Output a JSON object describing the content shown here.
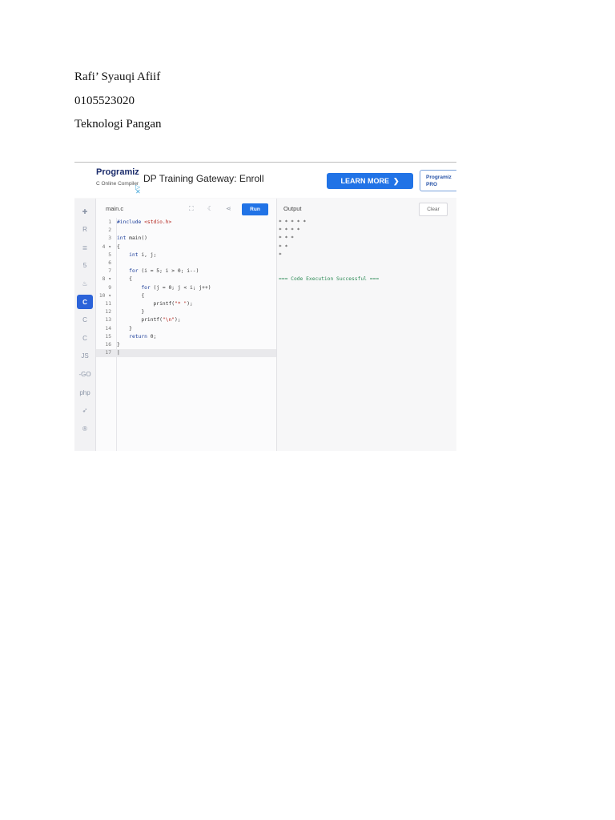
{
  "document": {
    "lines": [
      "Rafi’ Syauqi Afiif",
      "0105523020",
      "Teknologi Pangan"
    ]
  },
  "ad": {
    "logo_text": "Programiz",
    "logo_sub": "C Online Compiler",
    "title": "DP Training Gateway: Enroll",
    "learn_more": "LEARN MORE",
    "pro_label": "Programiz PRO",
    "close_glyph": "▷ ✕"
  },
  "sidebar": {
    "active_index": 5,
    "items": [
      {
        "icon": "python-icon",
        "glyph": "✚"
      },
      {
        "icon": "r-icon",
        "glyph": "R"
      },
      {
        "icon": "sql-icon",
        "glyph": "≣"
      },
      {
        "icon": "html-icon",
        "glyph": "5"
      },
      {
        "icon": "java-icon",
        "glyph": "♨"
      },
      {
        "icon": "c-icon",
        "glyph": "C"
      },
      {
        "icon": "cpp-icon",
        "glyph": "C"
      },
      {
        "icon": "csharp-icon",
        "glyph": "C"
      },
      {
        "icon": "javascript-icon",
        "glyph": "JS"
      },
      {
        "icon": "go-icon",
        "glyph": "-GO"
      },
      {
        "icon": "php-icon",
        "glyph": "php"
      },
      {
        "icon": "swift-icon",
        "glyph": "➶"
      },
      {
        "icon": "rust-icon",
        "glyph": "®"
      }
    ]
  },
  "editor": {
    "filename": "main.c",
    "run_label": "Run",
    "lines": [
      {
        "n": "1",
        "fold": "",
        "code": "#include <stdio.h>"
      },
      {
        "n": "2",
        "fold": "",
        "code": ""
      },
      {
        "n": "3",
        "fold": "",
        "code": "int main()"
      },
      {
        "n": "4",
        "fold": "▾",
        "code": "{"
      },
      {
        "n": "5",
        "fold": "",
        "code": "    int i, j;"
      },
      {
        "n": "6",
        "fold": "",
        "code": ""
      },
      {
        "n": "7",
        "fold": "",
        "code": "    for (i = 5; i > 0; i--)"
      },
      {
        "n": "8",
        "fold": "▾",
        "code": "    {"
      },
      {
        "n": "9",
        "fold": "",
        "code": "        for (j = 0; j < i; j++)"
      },
      {
        "n": "10",
        "fold": "▾",
        "code": "        {"
      },
      {
        "n": "11",
        "fold": "",
        "code": "            printf(\"* \");"
      },
      {
        "n": "12",
        "fold": "",
        "code": "        }"
      },
      {
        "n": "13",
        "fold": "",
        "code": "        printf(\"\\n\");"
      },
      {
        "n": "14",
        "fold": "",
        "code": "    }"
      },
      {
        "n": "15",
        "fold": "",
        "code": "    return 0;"
      },
      {
        "n": "16",
        "fold": "",
        "code": "}"
      },
      {
        "n": "17",
        "fold": "",
        "code": "|"
      }
    ]
  },
  "output": {
    "title": "Output",
    "clear_label": "Clear",
    "lines": [
      "* * * * *",
      "* * * *",
      "* * *",
      "* *",
      "*",
      "",
      "",
      "=== Code Execution Successful ==="
    ]
  },
  "colors": {
    "accent": "#2173e6",
    "success": "#2e8b57"
  }
}
